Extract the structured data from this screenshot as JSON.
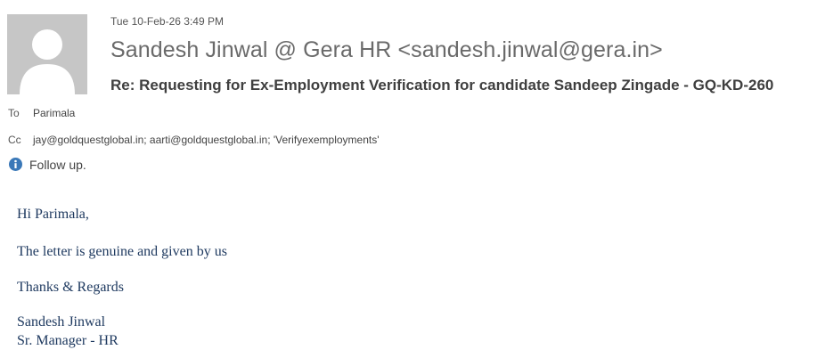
{
  "header": {
    "timestamp": "Tue 10-Feb-26 3:49 PM",
    "sender": "Sandesh Jinwal @ Gera HR <sandesh.jinwal@gera.in>",
    "subject": "Re: Requesting for Ex-Employment Verification for candidate Sandeep Zingade - GQ-KD-260"
  },
  "recipients": {
    "to_label": "To",
    "to_value": "Parimala",
    "cc_label": "Cc",
    "cc_value": "jay@goldquestglobal.in; aarti@goldquestglobal.in; 'Verifyexemployments'"
  },
  "flag": {
    "icon": "info-icon",
    "text": "Follow up."
  },
  "body": {
    "greeting": "Hi Parimala,",
    "message": "The letter is genuine and given by us",
    "closing": "Thanks & Regards",
    "signature_name": "Sandesh Jinwal",
    "signature_title": "Sr. Manager - HR"
  },
  "colors": {
    "avatar_bg": "#c6c6c6",
    "body_text": "#1f3a60",
    "info_icon": "#3a78b8"
  }
}
